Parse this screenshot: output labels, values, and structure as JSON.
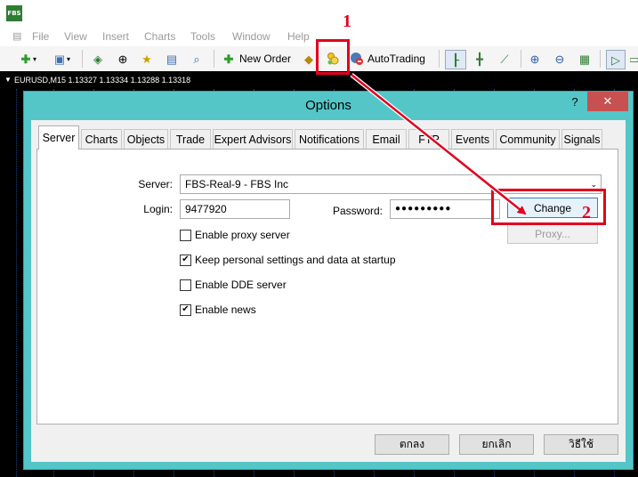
{
  "app": {
    "logo_text": "FBS"
  },
  "menu": [
    "File",
    "View",
    "Insert",
    "Charts",
    "Tools",
    "Window",
    "Help"
  ],
  "toolbar": {
    "new_order_label": "New Order",
    "autotrading_label": "AutoTrading"
  },
  "chart": {
    "header_text": "EURUSD,M15  1.13327 1.13334 1.13288 1.13318"
  },
  "dialog": {
    "title": "Options",
    "help_glyph": "?",
    "close_glyph": "✕",
    "tabs": [
      "Server",
      "Charts",
      "Objects",
      "Trade",
      "Expert Advisors",
      "Notifications",
      "Email",
      "FTP",
      "Events",
      "Community",
      "Signals"
    ],
    "active_tab": "Server",
    "server_label": "Server:",
    "server_value": "FBS-Real-9 - FBS Inc",
    "login_label": "Login:",
    "login_value": "9477920",
    "password_label": "Password:",
    "password_value": "●●●●●●●●●",
    "change_button": "Change",
    "proxy_button": "Proxy...",
    "checkboxes": [
      {
        "label": "Enable proxy server",
        "checked": false
      },
      {
        "label": "Keep personal settings and data at startup",
        "checked": true
      },
      {
        "label": "Enable DDE server",
        "checked": false
      },
      {
        "label": "Enable news",
        "checked": true
      }
    ],
    "ok_button": "ตกลง",
    "cancel_button": "ยกเลิก",
    "help_button": "วิธีใช้"
  },
  "annotations": {
    "step1": "1",
    "step2": "2",
    "color": "#e1001e"
  }
}
